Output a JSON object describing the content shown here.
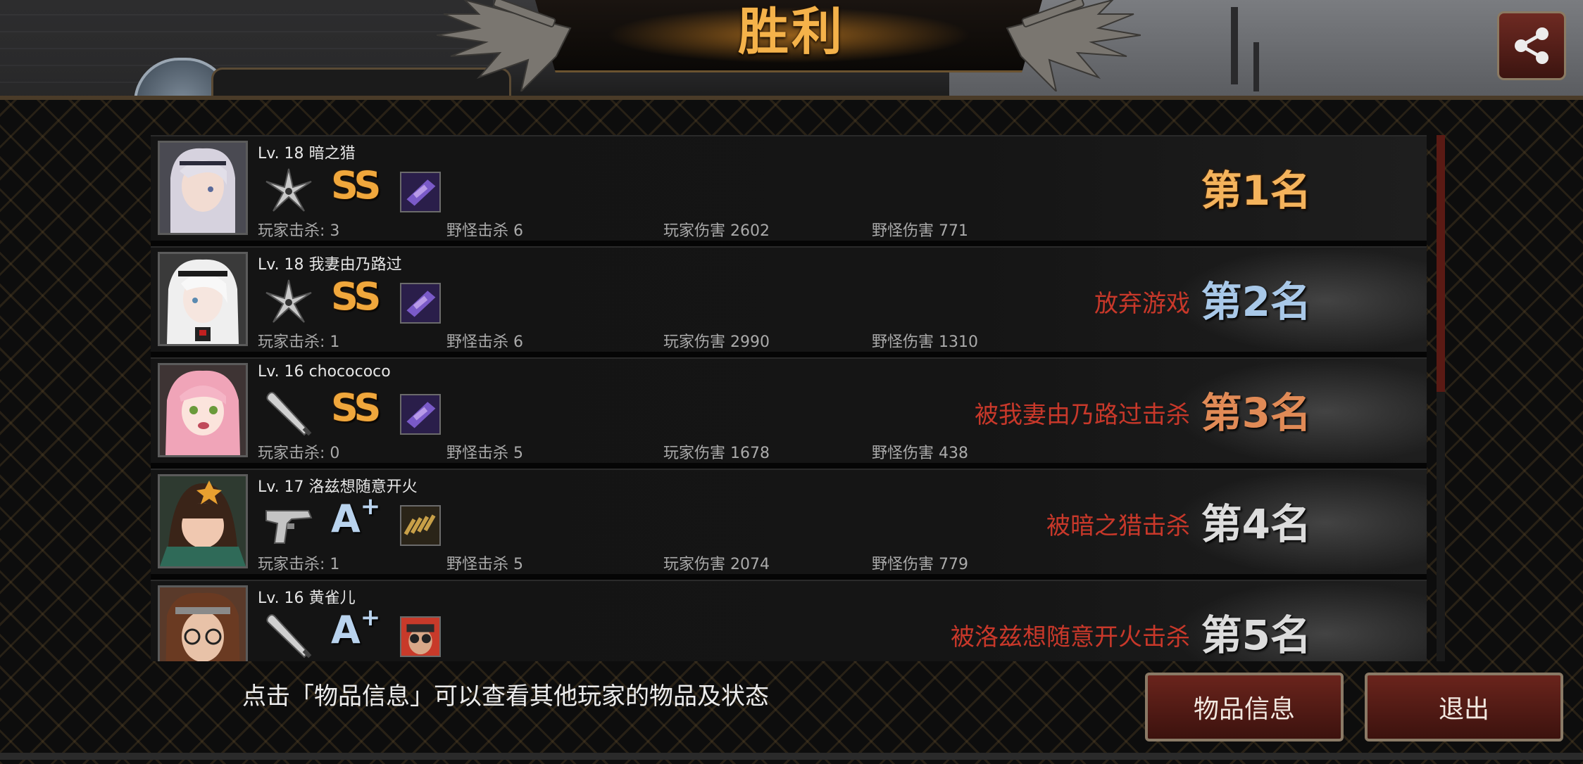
{
  "header": {
    "title": "胜利",
    "player_name_partial": "暗之猎"
  },
  "players": [
    {
      "level": "Lv. 18",
      "name": "暗之猎",
      "weapon_icon": "shuriken-icon",
      "grade": "SS",
      "item_icon": "purple-weapon-item-icon",
      "stats": {
        "player_kills": "玩家击杀: 3",
        "monster_kills": "野怪击杀 6",
        "player_damage": "玩家伤害 2602",
        "monster_damage": "野怪伤害 771"
      },
      "status": "",
      "rank": "第1名"
    },
    {
      "level": "Lv. 18",
      "name": "我妻由乃路过",
      "weapon_icon": "shuriken-icon",
      "grade": "SS",
      "item_icon": "purple-weapon-item-icon",
      "stats": {
        "player_kills": "玩家击杀: 1",
        "monster_kills": "野怪击杀 6",
        "player_damage": "玩家伤害 2990",
        "monster_damage": "野怪伤害 1310"
      },
      "status": "放弃游戏",
      "rank": "第2名"
    },
    {
      "level": "Lv. 16",
      "name": "chocococo",
      "weapon_icon": "baseball-bat-icon",
      "grade": "SS",
      "item_icon": "purple-weapon-item-icon",
      "stats": {
        "player_kills": "玩家击杀: 0",
        "monster_kills": "野怪击杀 5",
        "player_damage": "玩家伤害 1678",
        "monster_damage": "野怪伤害 438"
      },
      "status": "被我妻由乃路过击杀",
      "rank": "第3名"
    },
    {
      "level": "Lv. 17",
      "name": "洛兹想随意开火",
      "weapon_icon": "pistol-icon",
      "grade": "A",
      "grade_sup": "+",
      "item_icon": "ammo-belt-item-icon",
      "stats": {
        "player_kills": "玩家击杀: 1",
        "monster_kills": "野怪击杀 5",
        "player_damage": "玩家伤害 2074",
        "monster_damage": "野怪伤害 779"
      },
      "status": "被暗之猎击杀",
      "rank": "第4名"
    },
    {
      "level": "Lv. 16",
      "name": "黄雀儿",
      "weapon_icon": "baseball-bat-icon",
      "grade": "A",
      "grade_sup": "+",
      "item_icon": "binoculars-man-item-icon",
      "stats": {
        "player_kills": "",
        "monster_kills": "",
        "player_damage": "",
        "monster_damage": ""
      },
      "status": "被洛兹想随意开火击杀",
      "rank": "第5名"
    }
  ],
  "footer": {
    "hint": "点击「物品信息」可以查看其他玩家的物品及状态",
    "item_info_button": "物品信息",
    "exit_button": "退出"
  },
  "icons": {
    "share": "share-icon"
  },
  "colors": {
    "victory_gold": "#f4b24a",
    "status_red": "#c8382a",
    "button_red": "#6a241c"
  }
}
